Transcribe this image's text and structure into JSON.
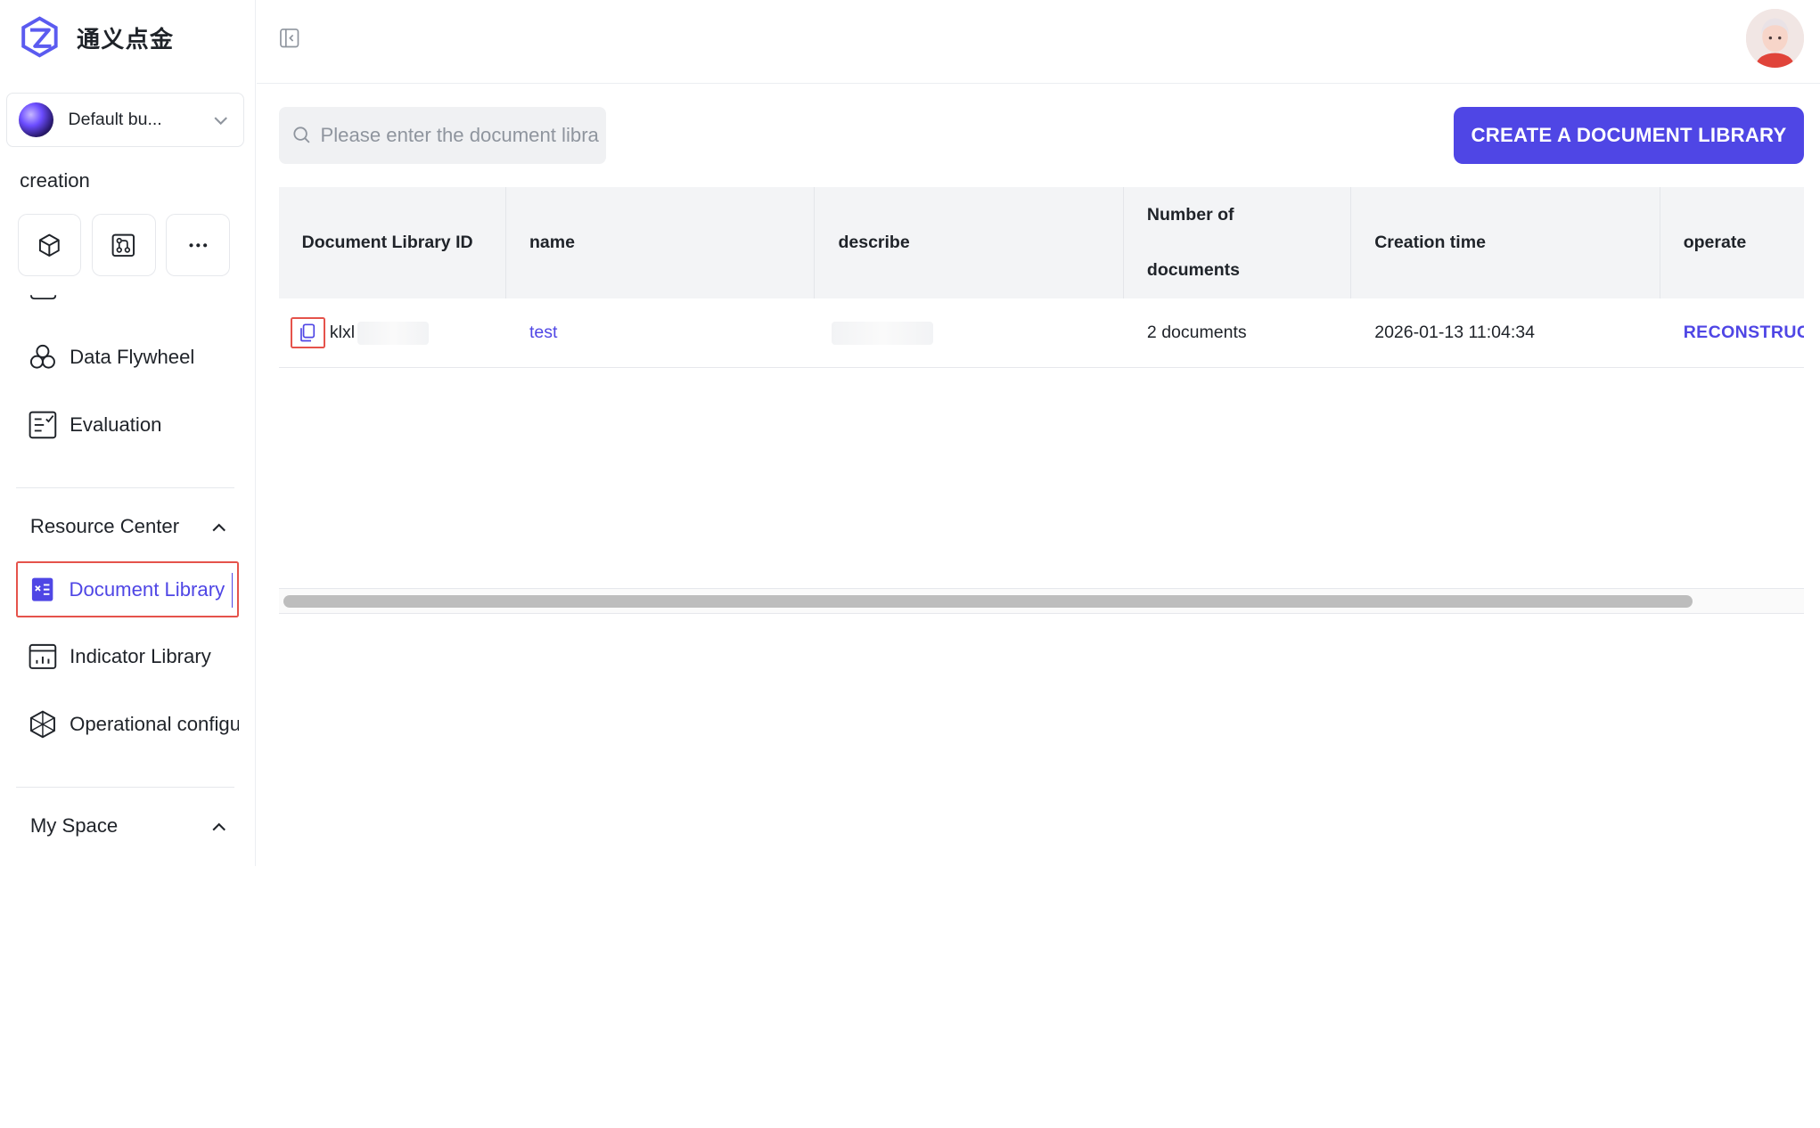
{
  "brand": {
    "title": "通义点金"
  },
  "workspace": {
    "name": "Default bu..."
  },
  "sidebar": {
    "section_label": "creation",
    "quick_actions": [
      {
        "icon": "cube-icon"
      },
      {
        "icon": "workflow-icon"
      },
      {
        "icon": "more-icon"
      }
    ],
    "items_creation": [
      {
        "label": "Data Flywheel",
        "icon": "flywheel-icon"
      },
      {
        "label": "Evaluation",
        "icon": "evaluation-icon"
      }
    ],
    "resource_center": {
      "title": "Resource Center",
      "items": [
        {
          "label": "Document Library",
          "icon": "document-library-icon",
          "active": true
        },
        {
          "label": "Indicator Library",
          "icon": "indicator-library-icon"
        },
        {
          "label": "Operational configuration",
          "icon": "operational-config-icon"
        }
      ]
    },
    "my_space": {
      "title": "My Space"
    }
  },
  "toolbar": {
    "search_placeholder": "Please enter the document library name",
    "create_label": "CREATE A DOCUMENT LIBRARY"
  },
  "table": {
    "columns": [
      "Document Library ID",
      "name",
      "describe",
      "Number of documents",
      "Creation time",
      "operate"
    ],
    "rows": [
      {
        "id": "klxl",
        "name": "test",
        "describe": "",
        "documents": "2 documents",
        "created": "2026-01-13 11:04:34",
        "operate": "RECONSTRUCT"
      }
    ]
  },
  "colors": {
    "accent": "#4f46e5",
    "highlight_box": "#e5534b",
    "header_bg": "#f3f4f6"
  }
}
